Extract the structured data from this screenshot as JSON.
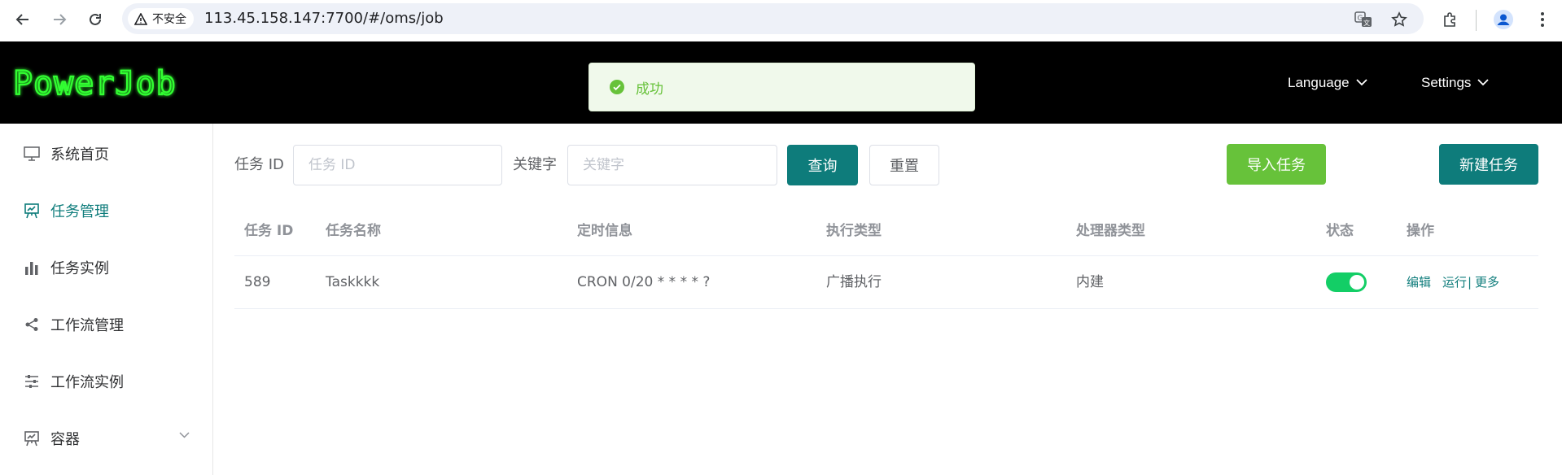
{
  "browser": {
    "security_label": "不安全",
    "url": "113.45.158.147:7700/#/oms/job"
  },
  "app": {
    "logo_text": "PowerJob",
    "header_menus": [
      {
        "label": "Language"
      },
      {
        "label": "Settings"
      }
    ]
  },
  "toast": {
    "message": "成功"
  },
  "sidebar": {
    "items": [
      {
        "label": "系统首页",
        "icon": "monitor-icon"
      },
      {
        "label": "任务管理",
        "icon": "presentation-icon",
        "active": true
      },
      {
        "label": "任务实例",
        "icon": "bar-chart-icon"
      },
      {
        "label": "工作流管理",
        "icon": "share-icon"
      },
      {
        "label": "工作流实例",
        "icon": "sliders-icon"
      },
      {
        "label": "容器",
        "icon": "easel-icon",
        "has_submenu": true
      }
    ]
  },
  "search": {
    "task_id_label": "任务 ID",
    "task_id_placeholder": "任务 ID",
    "task_id_value": "",
    "keyword_label": "关键字",
    "keyword_placeholder": "关键字",
    "keyword_value": "",
    "query_button": "查询",
    "reset_button": "重置"
  },
  "actions": {
    "import_button": "导入任务",
    "new_button": "新建任务"
  },
  "table": {
    "columns": [
      "任务 ID",
      "任务名称",
      "定时信息",
      "执行类型",
      "处理器类型",
      "状态",
      "操作"
    ],
    "rows": [
      {
        "id": "589",
        "name": "Taskkkk",
        "schedule": "CRON 0/20 * * * * ?",
        "exec_type": "广播执行",
        "processor_type": "内建",
        "enabled": true,
        "ops": {
          "edit": "编辑",
          "run": "运行",
          "sep": "|",
          "more": "更多"
        }
      }
    ]
  },
  "colors": {
    "accent": "#0e7c7b",
    "success": "#67c23a",
    "switch_on": "#13ce66"
  }
}
